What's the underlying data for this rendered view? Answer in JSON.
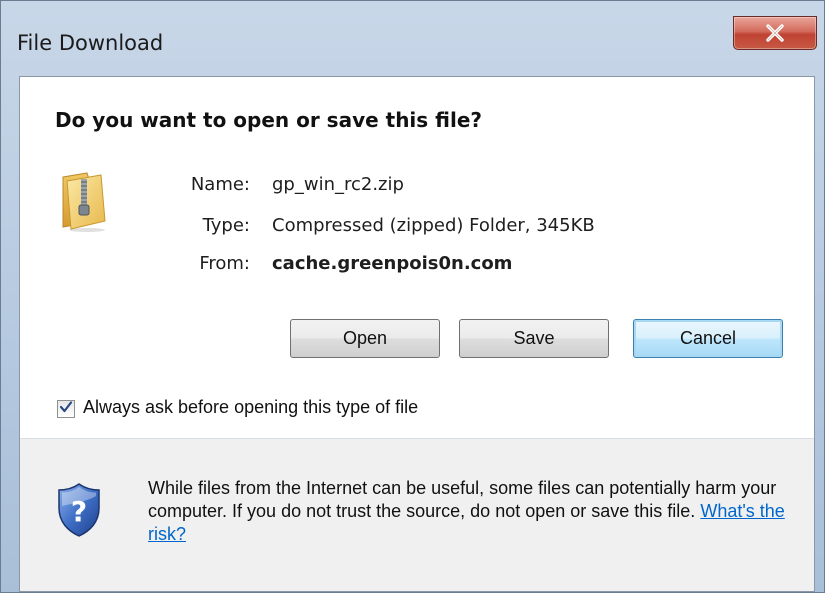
{
  "window": {
    "title": "File Download",
    "close_glyph": "X"
  },
  "dialog": {
    "question": "Do you want to open or save this file?",
    "file_icon": "zip-folder-icon",
    "fields": {
      "name_label": "Name:",
      "name_value": "gp_win_rc2.zip",
      "type_label": "Type:",
      "type_value": "Compressed (zipped) Folder, 345KB",
      "from_label": "From:",
      "from_value": "cache.greenpois0n.com"
    },
    "buttons": {
      "open": "Open",
      "save": "Save",
      "cancel": "Cancel"
    },
    "always_ask": {
      "label": "Always ask before opening this type of file",
      "checked": true
    }
  },
  "footer": {
    "icon": "shield-question-icon",
    "warning": "While files from the Internet can be useful, some files can potentially harm your computer. If you do not trust the source, do not open or save this file.",
    "risk_link": "What's the risk?"
  },
  "colors": {
    "link": "#0066cc",
    "close_button": "#c75a45",
    "default_button_border": "#3c7fb1"
  }
}
